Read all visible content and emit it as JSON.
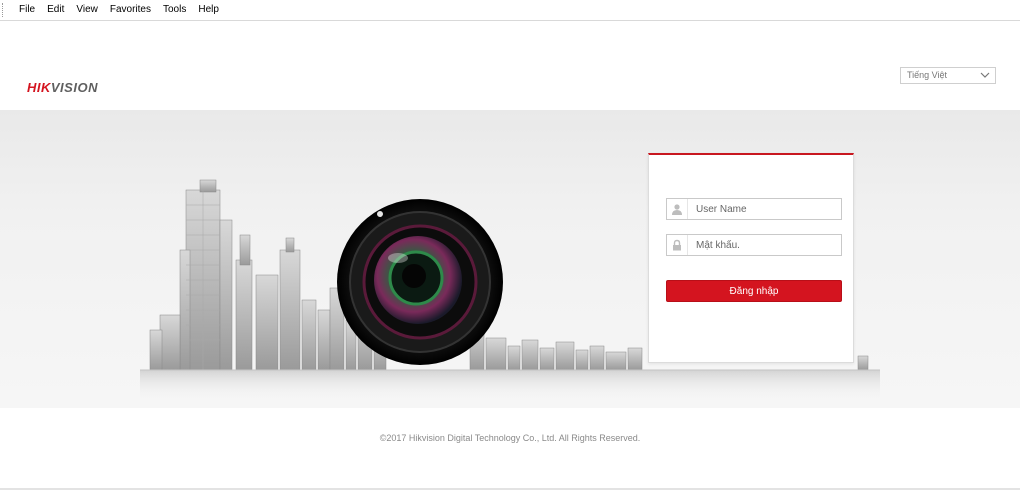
{
  "menubar": {
    "items": [
      {
        "label": "File"
      },
      {
        "label": "Edit"
      },
      {
        "label": "View"
      },
      {
        "label": "Favorites"
      },
      {
        "label": "Tools"
      },
      {
        "label": "Help"
      }
    ]
  },
  "header": {
    "logo_part1": "HIK",
    "logo_part2": "VISION",
    "language": {
      "selected": "Tiếng Việt"
    }
  },
  "login": {
    "username": {
      "value": "",
      "placeholder": "User Name"
    },
    "password": {
      "value": "",
      "placeholder": "Mật khẩu."
    },
    "submit_label": "Đăng nhập"
  },
  "footer": {
    "copyright": "©2017 Hikvision Digital Technology Co., Ltd. All Rights Reserved."
  },
  "colors": {
    "brand_red": "#d4141f",
    "hero_bg": "#f1f1f1",
    "text_muted": "#8a8a8a"
  },
  "icons": {
    "user_field": "user-icon",
    "password_field": "lock-icon",
    "language_dropdown": "chevron-down-icon"
  }
}
